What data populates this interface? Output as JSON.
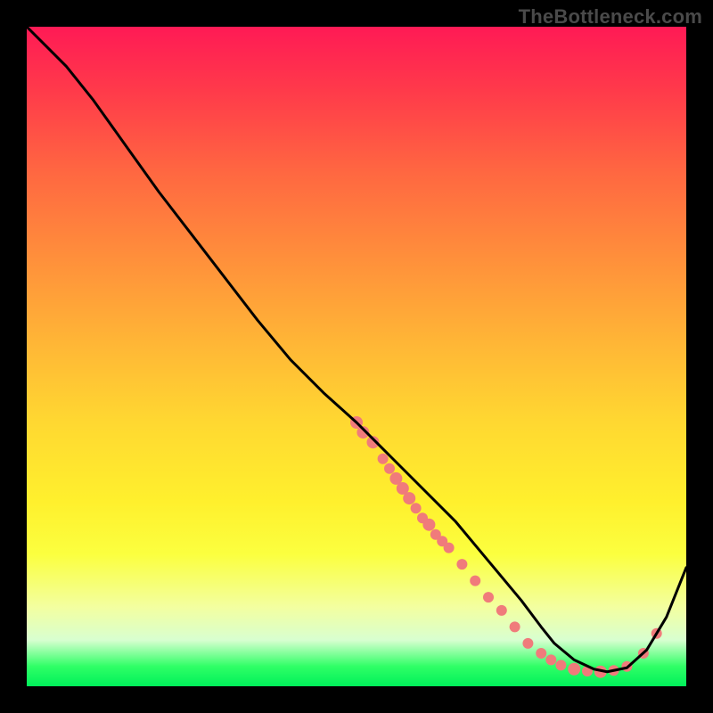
{
  "watermark": "TheBottleneck.com",
  "chart_data": {
    "type": "line",
    "title": "",
    "xlabel": "",
    "ylabel": "",
    "xlim": [
      0,
      100
    ],
    "ylim": [
      0,
      100
    ],
    "series": [
      {
        "name": "curve",
        "x": [
          0,
          3,
          6,
          10,
          15,
          20,
          25,
          30,
          35,
          40,
          45,
          50,
          55,
          60,
          65,
          70,
          75,
          78,
          80,
          83,
          86,
          88,
          91,
          94,
          97,
          100
        ],
        "y": [
          100,
          97,
          94,
          89,
          82,
          75,
          68.5,
          62,
          55.5,
          49.5,
          44.5,
          40,
          35,
          30,
          25,
          19,
          13,
          9,
          6.5,
          4,
          2.6,
          2.2,
          2.8,
          5.5,
          10.5,
          18
        ],
        "color": "#000000",
        "width": 3
      }
    ],
    "points": [
      {
        "x": 50,
        "y": 40,
        "r": 7
      },
      {
        "x": 51,
        "y": 38.5,
        "r": 7
      },
      {
        "x": 52.5,
        "y": 37,
        "r": 7
      },
      {
        "x": 54,
        "y": 34.5,
        "r": 6
      },
      {
        "x": 55,
        "y": 33,
        "r": 6
      },
      {
        "x": 56,
        "y": 31.5,
        "r": 7
      },
      {
        "x": 57,
        "y": 30,
        "r": 7
      },
      {
        "x": 58,
        "y": 28.5,
        "r": 7
      },
      {
        "x": 59,
        "y": 27,
        "r": 6
      },
      {
        "x": 60,
        "y": 25.5,
        "r": 6
      },
      {
        "x": 61,
        "y": 24.5,
        "r": 7
      },
      {
        "x": 62,
        "y": 23,
        "r": 6
      },
      {
        "x": 63,
        "y": 22,
        "r": 6
      },
      {
        "x": 64,
        "y": 21,
        "r": 6
      },
      {
        "x": 66,
        "y": 18.5,
        "r": 6
      },
      {
        "x": 68,
        "y": 16,
        "r": 6
      },
      {
        "x": 70,
        "y": 13.5,
        "r": 6
      },
      {
        "x": 72,
        "y": 11.5,
        "r": 6
      },
      {
        "x": 74,
        "y": 9,
        "r": 6
      },
      {
        "x": 76,
        "y": 6.5,
        "r": 6
      },
      {
        "x": 78,
        "y": 5,
        "r": 6
      },
      {
        "x": 79.5,
        "y": 4,
        "r": 6
      },
      {
        "x": 81,
        "y": 3.2,
        "r": 6
      },
      {
        "x": 83,
        "y": 2.6,
        "r": 7
      },
      {
        "x": 85,
        "y": 2.3,
        "r": 6
      },
      {
        "x": 87,
        "y": 2.2,
        "r": 7
      },
      {
        "x": 89,
        "y": 2.4,
        "r": 6
      },
      {
        "x": 91,
        "y": 3,
        "r": 6
      },
      {
        "x": 93.5,
        "y": 5,
        "r": 6
      },
      {
        "x": 95.5,
        "y": 8,
        "r": 6
      }
    ],
    "point_color": "#f07b7b"
  }
}
